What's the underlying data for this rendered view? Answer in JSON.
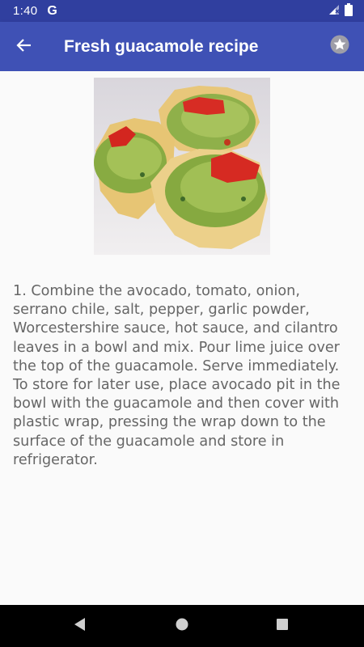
{
  "status_bar": {
    "time": "1:40",
    "notification": "G",
    "icons": [
      "google-notification-icon",
      "signal-icon",
      "battery-icon"
    ]
  },
  "app_bar": {
    "title": "Fresh guacamole recipe",
    "back_icon": "back-arrow-icon",
    "favorite_icon": "star-icon"
  },
  "content": {
    "image": "guacamole-tortilla-cups-photo",
    "directions": "1. Combine the avocado, tomato, onion, serrano chile, salt, pepper, garlic powder, Worcestershire sauce, hot sauce, and cilantro leaves in a bowl and mix. Pour lime juice over the top of the guacamole. Serve immediately. To store for later use, place avocado pit in the bowl with the guacamole and then cover with plastic wrap, pressing the wrap down to the surface of the guacamole and store in refrigerator."
  },
  "nav_bar": {
    "buttons": [
      "back-triangle-icon",
      "home-circle-icon",
      "recents-square-icon"
    ]
  },
  "colors": {
    "status_bar": "#303f9f",
    "app_bar": "#3f51b5",
    "background": "#fafafa",
    "body_text": "#666666",
    "nav_bar": "#000000"
  }
}
